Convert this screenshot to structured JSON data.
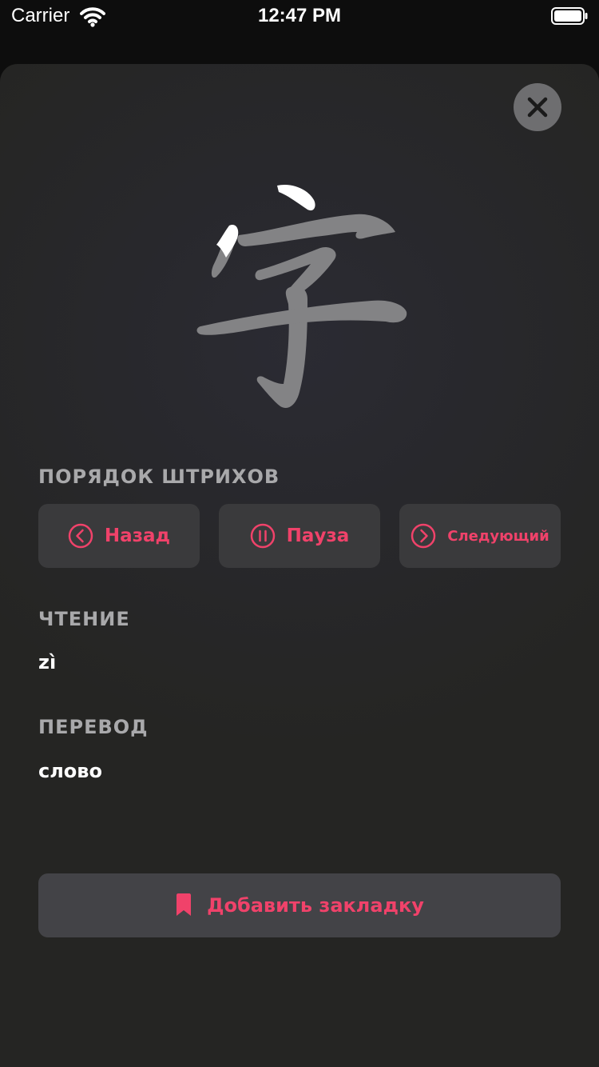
{
  "status_bar": {
    "carrier": "Carrier",
    "time": "12:47 PM"
  },
  "hanzi": {
    "character": "字",
    "stroke_color": "#838385",
    "highlight_color": "#ffffff"
  },
  "stroke_order": {
    "title": "ПОРЯДОК ШТРИХОВ",
    "back_label": "Назад",
    "pause_label": "Пауза",
    "next_label": "Следующий"
  },
  "reading": {
    "title": "ЧТЕНИЕ",
    "value": "zì"
  },
  "translation": {
    "title": "ПЕРЕВОД",
    "value": "слово"
  },
  "bookmark": {
    "label": "Добавить закладку"
  },
  "colors": {
    "accent": "#f0426a",
    "button_bg": "#3a3a3c",
    "label_gray": "#a9a9ab"
  }
}
